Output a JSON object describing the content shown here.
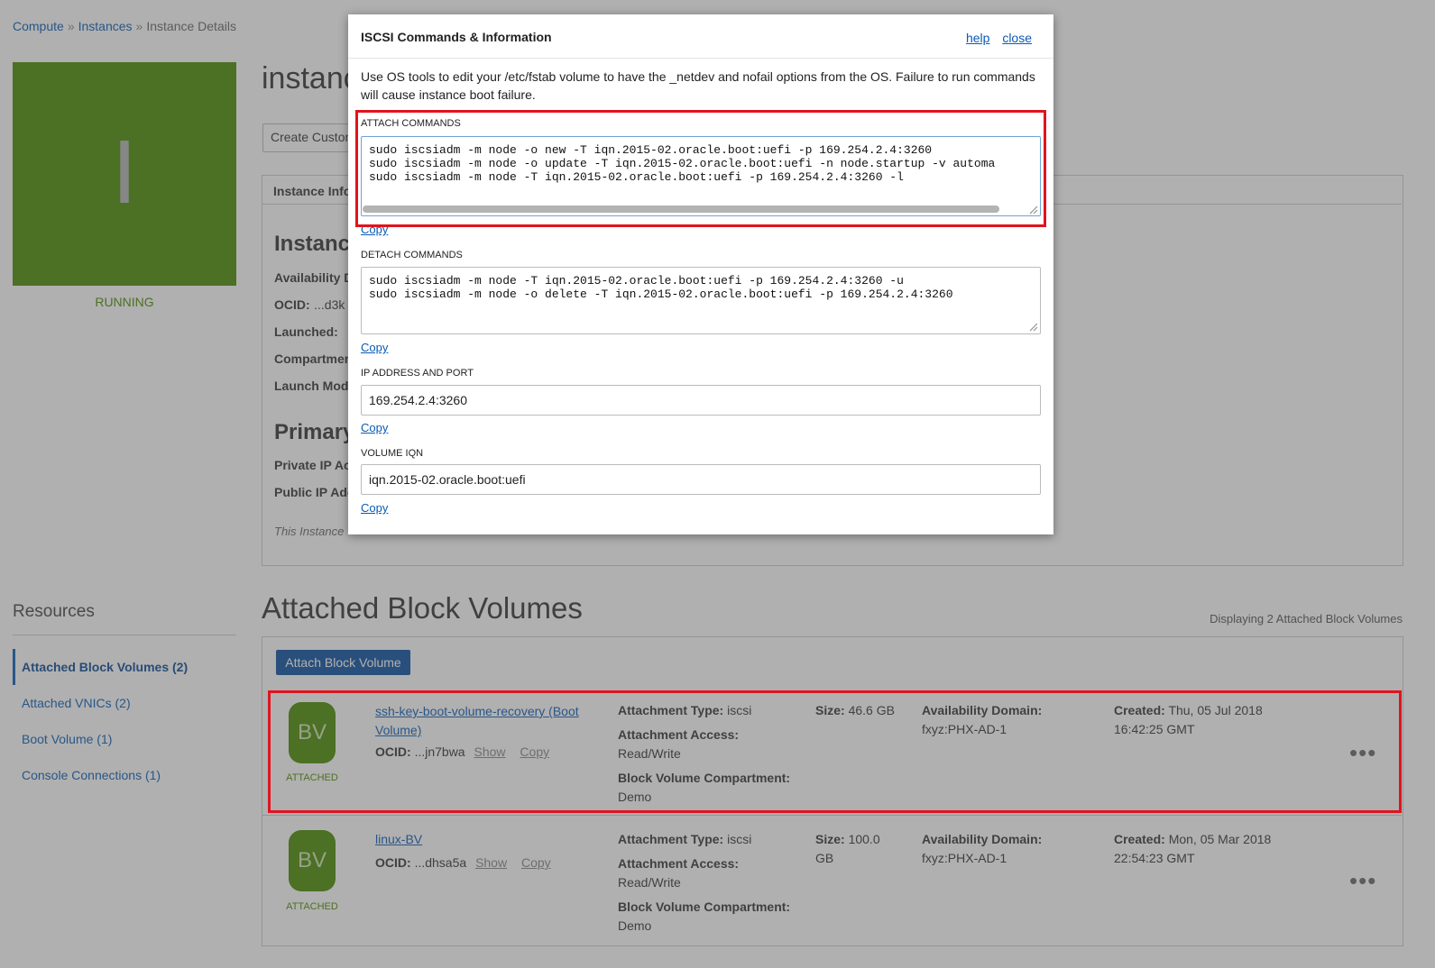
{
  "breadcrumb": {
    "compute": "Compute",
    "instances": "Instances",
    "current": "Instance Details",
    "sep": "»"
  },
  "instance": {
    "tile_letter": "I",
    "status": "RUNNING",
    "title": "instanc",
    "create_custom_button": "Create Custon",
    "tab_info": "Instance Info",
    "section_instance": "Instanc",
    "fields": {
      "availability": "Availability D",
      "ocid": "OCID:",
      "ocid_value": "...d3k",
      "launched": "Launched:",
      "compartment": "Compartmen",
      "launch_mode": "Launch Mod"
    },
    "section_primary": "Primary",
    "primary_fields": {
      "private_ip": "Private IP Ac",
      "public_ip": "Public IP Add"
    },
    "note": "This Instance"
  },
  "resources": {
    "title": "Resources",
    "items": [
      {
        "label": "Attached Block Volumes (2)",
        "active": true
      },
      {
        "label": "Attached VNICs (2)",
        "active": false
      },
      {
        "label": "Boot Volume (1)",
        "active": false
      },
      {
        "label": "Console Connections (1)",
        "active": false
      }
    ]
  },
  "block_volumes": {
    "title": "Attached Block Volumes",
    "count_text": "Displaying 2 Attached Block Volumes",
    "attach_button": "Attach Block Volume",
    "rows": [
      {
        "icon_text": "BV",
        "status": "ATTACHED",
        "name": "ssh-key-boot-volume-recovery (Boot Volume)",
        "ocid_label": "OCID:",
        "ocid_value": "...jn7bwa",
        "show": "Show",
        "copy": "Copy",
        "attachment_type_label": "Attachment Type:",
        "attachment_type": "iscsi",
        "attachment_access_label": "Attachment Access:",
        "attachment_access": "Read/Write",
        "compartment_label": "Block Volume Compartment:",
        "compartment": "Demo",
        "size_label": "Size:",
        "size": "46.6 GB",
        "ad_label": "Availability Domain:",
        "ad": "fxyz:PHX-AD-1",
        "created_label": "Created:",
        "created_line1": "Thu, 05 Jul 2018",
        "created_line2": "16:42:25 GMT",
        "menu": "•••"
      },
      {
        "icon_text": "BV",
        "status": "ATTACHED",
        "name": "linux-BV",
        "ocid_label": "OCID:",
        "ocid_value": "...dhsa5a",
        "show": "Show",
        "copy": "Copy",
        "attachment_type_label": "Attachment Type:",
        "attachment_type": "iscsi",
        "attachment_access_label": "Attachment Access:",
        "attachment_access": "Read/Write",
        "compartment_label": "Block Volume Compartment:",
        "compartment": "Demo",
        "size_label": "Size:",
        "size_line1": "100.0",
        "size_line2": "GB",
        "ad_label": "Availability Domain:",
        "ad": "fxyz:PHX-AD-1",
        "created_label": "Created:",
        "created_line1": "Mon, 05 Mar 2018",
        "created_line2": "22:54:23 GMT",
        "menu": "•••"
      }
    ]
  },
  "modal": {
    "title": "ISCSI Commands & Information",
    "help": "help",
    "close": "close",
    "description": "Use OS tools to edit your /etc/fstab volume to have the _netdev and nofail options from the OS. Failure to run commands will cause instance boot failure.",
    "attach": {
      "label": "ATTACH COMMANDS",
      "lines": [
        "sudo iscsiadm -m node -o new -T iqn.2015-02.oracle.boot:uefi -p 169.254.2.4:3260",
        "sudo iscsiadm -m node -o update -T iqn.2015-02.oracle.boot:uefi -n node.startup -v automa",
        "sudo iscsiadm -m node -T iqn.2015-02.oracle.boot:uefi -p 169.254.2.4:3260 -l"
      ],
      "copy": "Copy"
    },
    "detach": {
      "label": "DETACH COMMANDS",
      "lines": [
        "sudo iscsiadm -m node -T iqn.2015-02.oracle.boot:uefi -p 169.254.2.4:3260 -u",
        "sudo iscsiadm -m node -o delete -T iqn.2015-02.oracle.boot:uefi -p 169.254.2.4:3260"
      ],
      "copy": "Copy"
    },
    "ip_port": {
      "label": "IP ADDRESS AND PORT",
      "value": "169.254.2.4:3260",
      "copy": "Copy"
    },
    "volume_iqn": {
      "label": "VOLUME IQN",
      "value": "iqn.2015-02.oracle.boot:uefi",
      "copy": "Copy"
    }
  },
  "colors": {
    "brand_green": "#4a8a00",
    "link_blue": "#0a5bb5",
    "primary_button": "#0a4fa0",
    "highlight_red": "#e0141e"
  }
}
